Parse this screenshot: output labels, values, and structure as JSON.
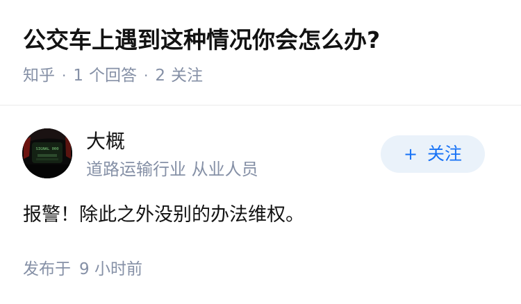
{
  "question": {
    "title": "公交车上遇到这种情况你会怎么办?",
    "source": "知乎",
    "separator": "·",
    "answer_count": "1",
    "answer_label": "个回答",
    "follower_count": "2",
    "follower_label": "关注"
  },
  "answer": {
    "author": {
      "name": "大概",
      "bio": "道路运输行业 从业人员",
      "follow_icon": "+",
      "follow_label": "关注",
      "avatar_screen_text": "SIGNAL 000"
    },
    "content": "报警！除此之外没别的办法维权。",
    "footer": {
      "published_label": "发布于",
      "time": "9 小时前"
    }
  },
  "colors": {
    "title": "#121212",
    "meta": "#8590a6",
    "accent": "#1772f6",
    "follow_bg": "#eaf2fa",
    "divider": "#ebebeb"
  }
}
